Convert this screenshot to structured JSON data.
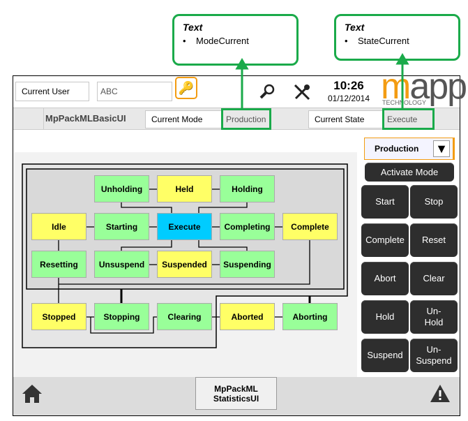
{
  "callouts": [
    {
      "title": "Text",
      "item": "ModeCurrent"
    },
    {
      "title": "Text",
      "item": "StateCurrent"
    }
  ],
  "header": {
    "current_user_label": "Current User",
    "user_value": "ABC",
    "time": "10:26",
    "date": "01/12/2014",
    "logo_text": "mapp",
    "logo_sub": "TECHNOLOGY"
  },
  "subheader": {
    "title": "MpPackMLBasicUI",
    "current_mode_label": "Current Mode",
    "current_mode": "Production",
    "current_state_label": "Current State",
    "current_state": "Execute"
  },
  "states": [
    {
      "name": "Unholding",
      "color": "green"
    },
    {
      "name": "Held",
      "color": "yellow"
    },
    {
      "name": "Holding",
      "color": "green"
    },
    {
      "name": "Idle",
      "color": "yellow"
    },
    {
      "name": "Starting",
      "color": "green"
    },
    {
      "name": "Execute",
      "color": "blue"
    },
    {
      "name": "Completing",
      "color": "green"
    },
    {
      "name": "Complete",
      "color": "yellow"
    },
    {
      "name": "Resetting",
      "color": "green"
    },
    {
      "name": "Unsuspend",
      "color": "green"
    },
    {
      "name": "Suspended",
      "color": "yellow"
    },
    {
      "name": "Suspending",
      "color": "green"
    },
    {
      "name": "Stopped",
      "color": "yellow"
    },
    {
      "name": "Stopping",
      "color": "green"
    },
    {
      "name": "Clearing",
      "color": "green"
    },
    {
      "name": "Aborted",
      "color": "yellow"
    },
    {
      "name": "Aborting",
      "color": "green"
    }
  ],
  "mode_select": {
    "selected": "Production"
  },
  "activate_mode": "Activate Mode",
  "commands": [
    "Start",
    "Stop",
    "Complete",
    "Reset",
    "Abort",
    "Clear",
    "Hold",
    "Un-\nHold",
    "Suspend",
    "Un-\nSuspend"
  ],
  "footer": {
    "statistics_button": "MpPackML\nStatisticsUI"
  },
  "colors": {
    "green": "#99ff99",
    "yellow": "#ffff66",
    "blue": "#00ccff",
    "highlight": "#1aaa4a",
    "accent": "#f39c12"
  }
}
